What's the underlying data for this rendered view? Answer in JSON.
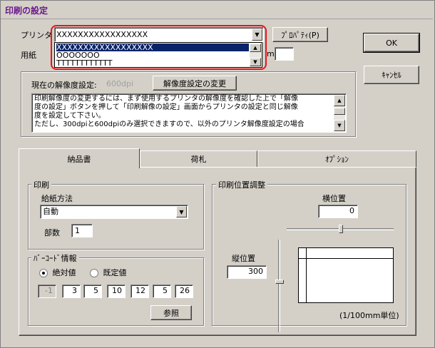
{
  "window": {
    "title": "印刷の設定"
  },
  "printer": {
    "label": "プリンタ",
    "selected": "XXXXXXXXXXXXXXXXX",
    "options": [
      "XXXXXXXXXXXXXXXXXX",
      "OOOOOOO",
      "TTTTTTTTTTTT"
    ],
    "properties_button": "ﾌﾟﾛﾊﾟﾃｨ(P)",
    "highlight_color": "#e8141c",
    "selection_color": "#0a246a"
  },
  "paper": {
    "label": "用紙",
    "unit_fragment": "m"
  },
  "resolution": {
    "current_label": "現在の解像度設定:",
    "current_value": "600dpi",
    "change_button": "解像度設定の変更",
    "note_lines": [
      "印刷解像度の変更するには、まず使用するプリンタの解像度を確認した上で「解像",
      "度の設定」ボタンを押して「印刷解像の設定」画面からプリンタの設定と同じ解像",
      "度を設定して下さい。",
      "ただし、300dpiと600dpiのみ選択できますので、以外のプリンタ解像度設定の場合"
    ]
  },
  "buttons": {
    "ok": "OK",
    "cancel": "ｷｬﾝｾﾙ"
  },
  "tabs": [
    {
      "label": "納品書",
      "active": true
    },
    {
      "label": "荷札",
      "active": false
    },
    {
      "label": "ｵﾌﾟｼｮﾝ",
      "active": false
    }
  ],
  "print": {
    "title": "印刷",
    "feed_label": "給紙方法",
    "feed_value": "自動",
    "copies_label": "部数",
    "copies_value": "1"
  },
  "barcode": {
    "title": "ﾊﾞｰｺｰﾄﾞ情報",
    "absolute_label": "絶対値",
    "default_label": "既定値",
    "mode": "絶対値",
    "values": [
      "-1",
      "3",
      "5",
      "10",
      "12",
      "5",
      "26"
    ],
    "browse_button": "参照"
  },
  "position": {
    "title": "印刷位置調整",
    "horizontal_label": "横位置",
    "horizontal_value": "0",
    "vertical_label": "縦位置",
    "vertical_value": "300",
    "unit": "(1/100mm単位)"
  }
}
